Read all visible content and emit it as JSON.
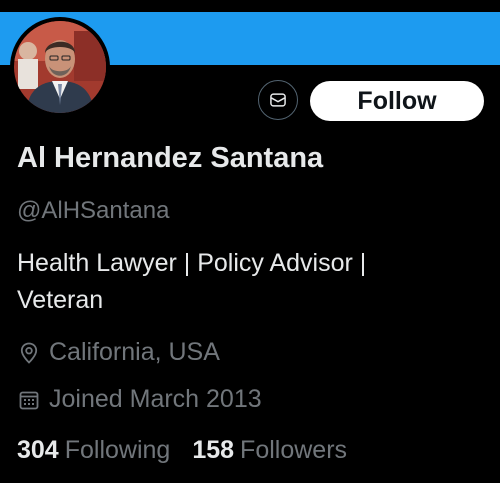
{
  "profile": {
    "display_name": "Al Hernandez Santana",
    "handle": "@AlHSantana",
    "bio": "Health Lawyer | Policy Advisor | Veteran",
    "location": "California, USA",
    "joined": "Joined March 2013",
    "following_count": "304",
    "following_label": "Following",
    "followers_count": "158",
    "followers_label": "Followers"
  },
  "actions": {
    "message_icon": "mail-icon",
    "follow_label": "Follow"
  },
  "icons": {
    "location": "location-pin-icon",
    "joined": "calendar-icon"
  },
  "colors": {
    "banner": "#1d9bf0",
    "background": "#000000",
    "primary_text": "#e7e9ea",
    "secondary_text": "#71767b",
    "follow_button_bg": "#ffffff"
  }
}
